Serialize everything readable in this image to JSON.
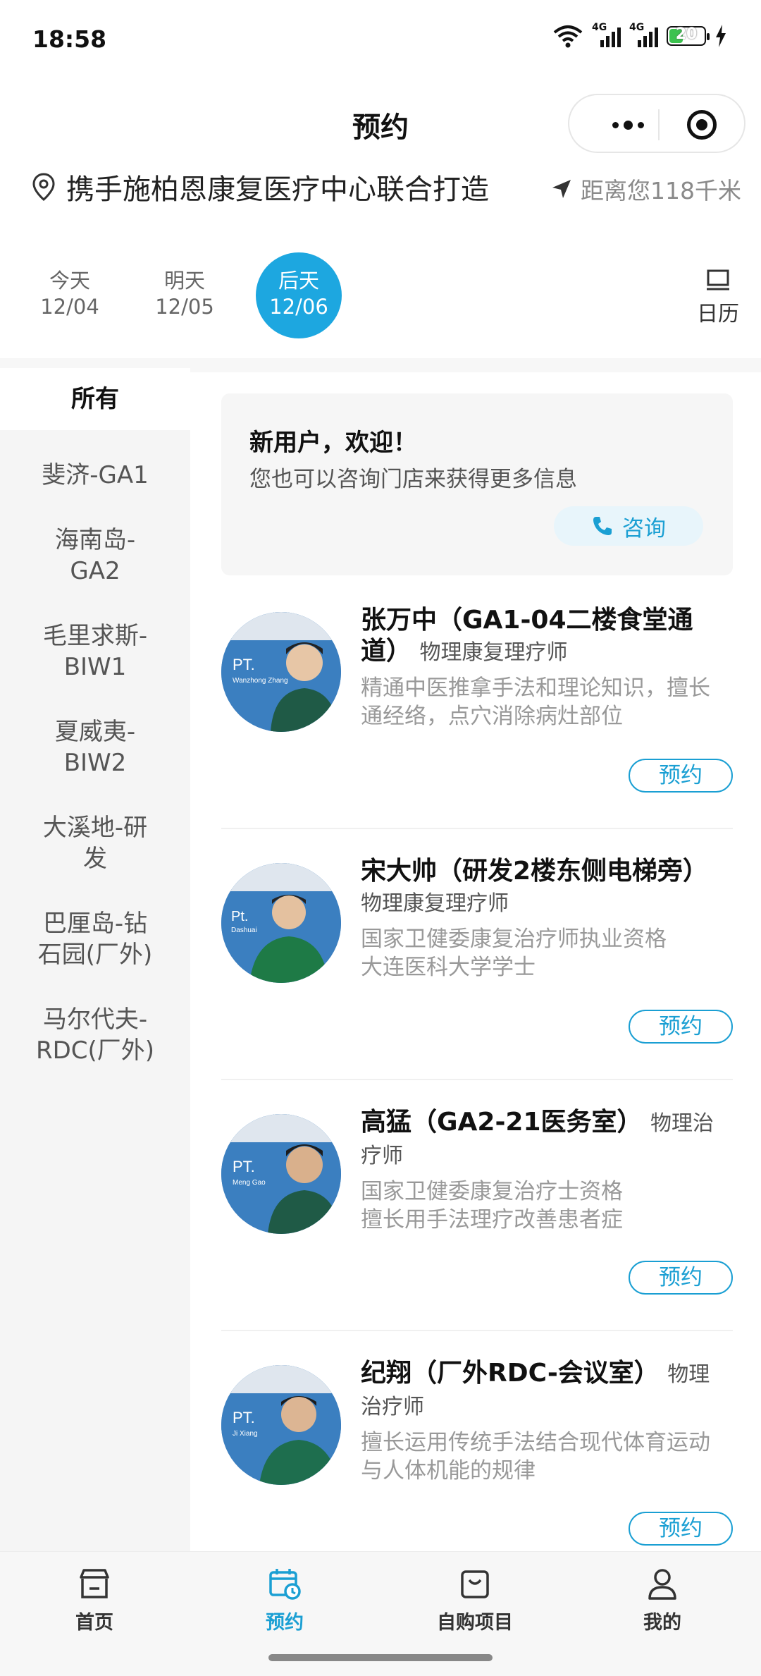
{
  "status_bar": {
    "time": "18:58",
    "battery": "20",
    "net1": "4G",
    "net2": "4G"
  },
  "nav": {
    "title": "预约"
  },
  "location": {
    "text": "携手施柏恩康复医疗中心联合打造",
    "distance": "距离您118千米"
  },
  "dates": [
    {
      "day": "今天",
      "date": "12/04",
      "selected": false
    },
    {
      "day": "明天",
      "date": "12/05",
      "selected": false
    },
    {
      "day": "后天",
      "date": "12/06",
      "selected": true
    }
  ],
  "calendar_label": "日历",
  "sidebar": {
    "items": [
      {
        "label": "所有",
        "active": true
      },
      {
        "label": "斐济-GA1"
      },
      {
        "label": "海南岛-GA2"
      },
      {
        "label": "毛里求斯-BIW1"
      },
      {
        "label": "夏威夷-BIW2"
      },
      {
        "label": "大溪地-研发"
      },
      {
        "label": "巴厘岛-钻石园(厂外)"
      },
      {
        "label": "马尔代夫-RDC(厂外)"
      }
    ]
  },
  "welcome": {
    "title": "新用户，欢迎！",
    "subtitle": "您也可以咨询门店来获得更多信息",
    "consult_label": "咨询"
  },
  "therapists": [
    {
      "name": "张万中（GA1-04二楼食堂通道）",
      "role": "物理康复理疗师",
      "desc": [
        "精通中医推拿手法和理论知识，擅长通经络，点穴消除病灶部位"
      ],
      "book": "预约",
      "avatar_text": "PT.",
      "avatar_name": "Wanzhong Zhang"
    },
    {
      "name": "宋大帅（研发2楼东侧电梯旁）",
      "role": "物理康复理疗师",
      "desc": [
        "国家卫健委康复治疗师执业资格",
        "大连医科大学学士"
      ],
      "book": "预约",
      "avatar_text": "Pt.",
      "avatar_name": "Dashuai"
    },
    {
      "name": "高猛（GA2-21医务室）",
      "role": "物理治疗师",
      "desc": [
        "国家卫健委康复治疗士资格",
        "擅长用手法理疗改善患者症"
      ],
      "book": "预约",
      "avatar_text": "PT.",
      "avatar_name": "Meng Gao"
    },
    {
      "name": "纪翔（厂外RDC-会议室）",
      "role": "物理治疗师",
      "desc": [
        "擅长运用传统手法结合现代体育运动与人体机能的规律"
      ],
      "book": "预约",
      "avatar_text": "PT.",
      "avatar_name": "Ji Xiang"
    }
  ],
  "tabbar": {
    "items": [
      {
        "label": "首页",
        "icon": "store-icon"
      },
      {
        "label": "预约",
        "icon": "calendar-clock-icon",
        "active": true
      },
      {
        "label": "自购项目",
        "icon": "bag-icon"
      },
      {
        "label": "我的",
        "icon": "user-icon"
      }
    ]
  },
  "colors": {
    "accent": "#1da7e0",
    "link": "#1a9fd3"
  }
}
